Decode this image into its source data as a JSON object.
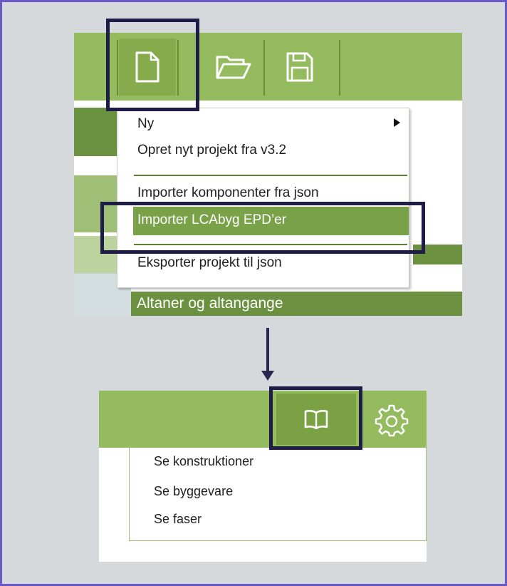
{
  "colors": {
    "frame_border": "#6a58c6",
    "background": "#d6d9dc",
    "toolbar_green": "#94bb5d",
    "active_green": "#79a248",
    "dark_green": "#6b9140",
    "highlight_frame": "#1f1c48"
  },
  "toolbar": {
    "icons": [
      "new-file-icon",
      "open-folder-icon",
      "save-disk-icon"
    ]
  },
  "file_menu": {
    "items": [
      {
        "label": "Ny",
        "has_submenu": true
      },
      {
        "label": "Opret nyt projekt fra v3.2"
      },
      {
        "label": "Importer komponenter fra json"
      },
      {
        "label": "Importer LCAbyg EPD’er",
        "highlighted": true
      },
      {
        "label": "Eksporter projekt til json"
      }
    ]
  },
  "background_row": {
    "label": "Altaner og altangange"
  },
  "toolbar2": {
    "icons": [
      "book-icon",
      "gear-icon"
    ]
  },
  "book_menu": {
    "items": [
      {
        "label": "Se konstruktioner"
      },
      {
        "label": "Se byggevare"
      },
      {
        "label": "Se faser"
      }
    ]
  }
}
